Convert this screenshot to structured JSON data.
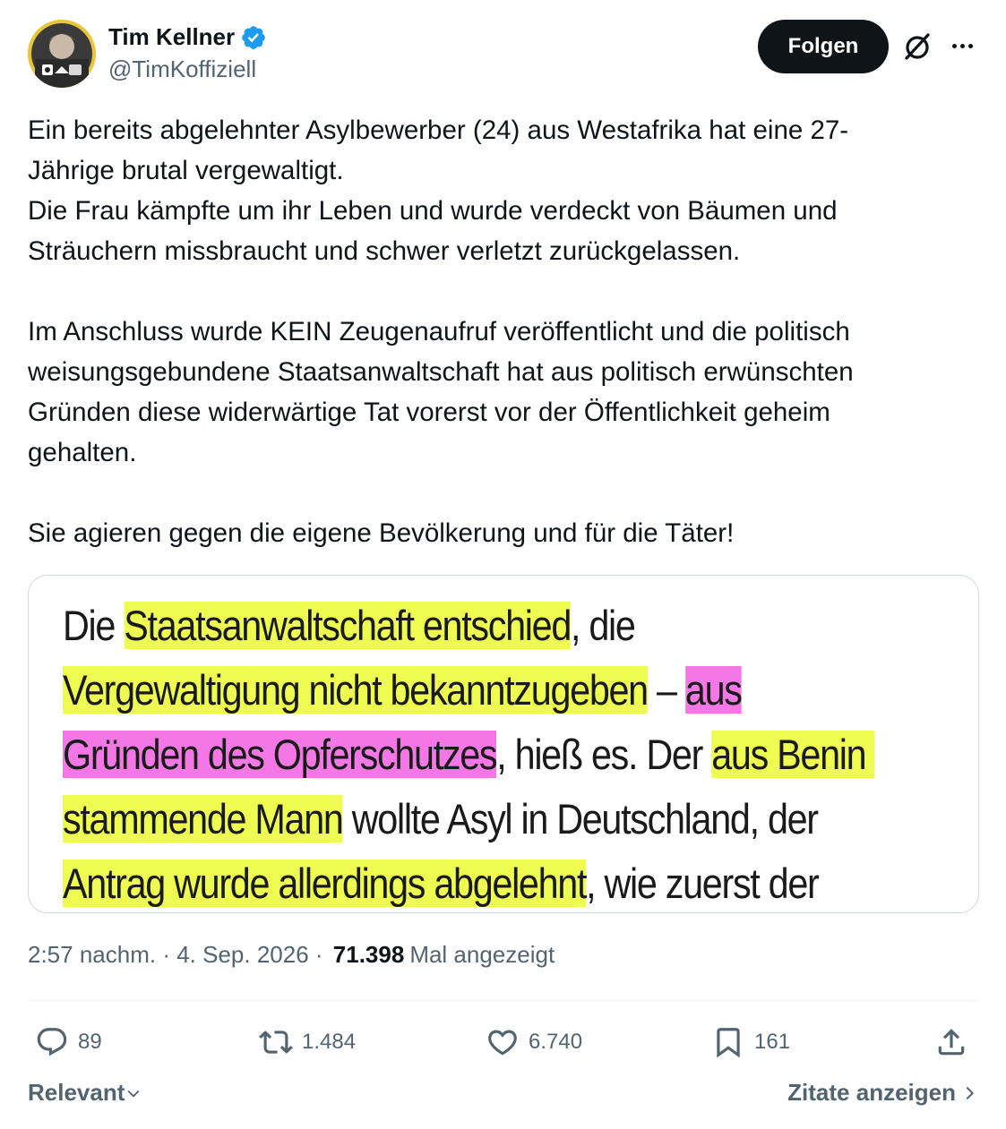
{
  "author": {
    "display_name": "Tim Kellner",
    "handle": "@TimKoffiziell",
    "verified": true
  },
  "header": {
    "follow_label": "Folgen",
    "icons": [
      "grok-icon",
      "more-icon"
    ]
  },
  "tweet": {
    "paragraphs": [
      "Ein bereits abgelehnter Asylbewerber (24) aus Westafrika hat eine 27-",
      "Jährige brutal vergewaltigt.",
      "Die Frau kämpfte um ihr Leben und wurde verdeckt von Bäumen und",
      "Sträuchern missbraucht und schwer verletzt zurückgelassen.",
      "Im Anschluss wurde KEIN Zeugenaufruf veröffentlicht und die politisch",
      "weisungsgebundene Staatsanwaltschaft hat aus politisch erwünschten",
      "Gründen diese widerwärtige Tat vorerst vor der Öffentlichkeit geheim",
      "gehalten.",
      "Sie agieren gegen die eigene Bevölkerung und für die Täter!"
    ]
  },
  "media": {
    "lines": [
      [
        {
          "t": "Die ",
          "h": ""
        },
        {
          "t": "Staatsanwaltschaft entschied",
          "h": "y"
        },
        {
          "t": ", die",
          "h": ""
        }
      ],
      [
        {
          "t": "Vergewaltigung nicht bekanntzugeben",
          "h": "y"
        },
        {
          "t": " – ",
          "h": ""
        },
        {
          "t": "aus",
          "h": "p"
        }
      ],
      [
        {
          "t": "Gründen des Opferschutzes",
          "h": "p"
        },
        {
          "t": ", hieß es. Der ",
          "h": ""
        },
        {
          "t": "aus Benin ",
          "h": "y"
        }
      ],
      [
        {
          "t": "stammende Mann",
          "h": "y"
        },
        {
          "t": " wollte Asyl in Deutschland, der",
          "h": ""
        }
      ],
      [
        {
          "t": "Antrag wurde allerdings abgelehnt",
          "h": "y"
        },
        {
          "t": ", wie zuerst der",
          "h": ""
        }
      ]
    ],
    "highlight_colors": {
      "y": "#eefc52",
      "p": "#f477e6"
    }
  },
  "meta": {
    "time": "2:57 nachm.",
    "sep1": " · ",
    "date": "4. Sep. 2026",
    "sep2": " · ",
    "views_count": "71.398",
    "views_label": "Mal angezeigt"
  },
  "actions": {
    "replies": "89",
    "reposts": "1.484",
    "likes": "6.740",
    "bookmarks": "161"
  },
  "footer": {
    "sort_label": "Relevant",
    "quotes_label": "Zitate anzeigen"
  },
  "colors": {
    "text": "#0f1419",
    "muted": "#536471",
    "verified": "#1d9bf0",
    "border": "#cfd9de"
  }
}
